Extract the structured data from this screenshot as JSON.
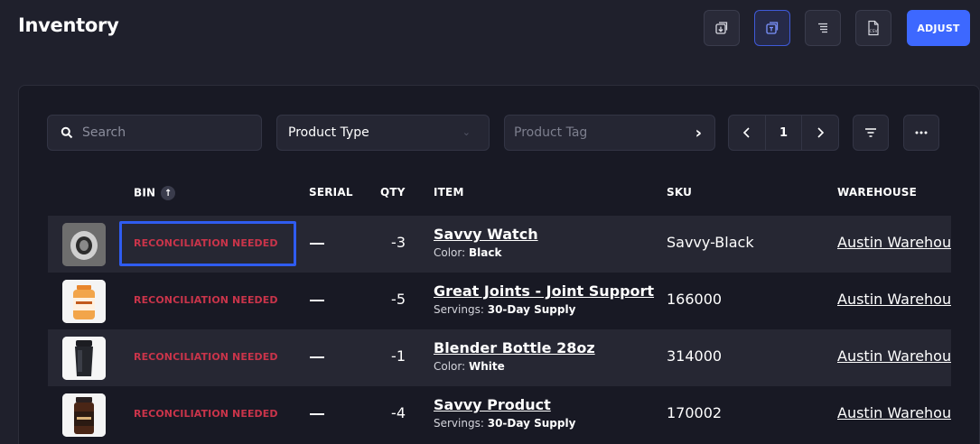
{
  "header": {
    "title": "Inventory",
    "adjust_label": "ADJUST",
    "icons": [
      "import-icon",
      "copy-icon",
      "tree-list-icon",
      "csv-file-icon"
    ]
  },
  "filters": {
    "search_placeholder": "Search",
    "product_type": "Product Type",
    "product_tag_placeholder": "Product Tag",
    "page_number": "1"
  },
  "table": {
    "columns": {
      "bin": "BIN",
      "serial": "SERIAL",
      "qty": "QTY",
      "item": "ITEM",
      "sku": "SKU",
      "warehouse": "WAREHOUSE"
    },
    "rows": [
      {
        "bin": "RECONCILIATION NEEDED",
        "serial": "—",
        "qty": "-3",
        "item_name": "Savvy Watch",
        "attr_label": "Color:",
        "attr_value": "Black",
        "sku": "Savvy-Black",
        "warehouse": "Austin Warehouse"
      },
      {
        "bin": "RECONCILIATION NEEDED",
        "serial": "—",
        "qty": "-5",
        "item_name": "Great Joints - Joint Support",
        "attr_label": "Servings:",
        "attr_value": "30-Day Supply",
        "sku": "166000",
        "warehouse": "Austin Warehouse"
      },
      {
        "bin": "RECONCILIATION NEEDED",
        "serial": "—",
        "qty": "-1",
        "item_name": "Blender Bottle 28oz",
        "attr_label": "Color:",
        "attr_value": "White",
        "sku": "314000",
        "warehouse": "Austin Warehouse"
      },
      {
        "bin": "RECONCILIATION NEEDED",
        "serial": "—",
        "qty": "-4",
        "item_name": "Savvy Product",
        "attr_label": "Servings:",
        "attr_value": "30-Day Supply",
        "sku": "170002",
        "warehouse": "Austin Warehouse"
      }
    ]
  },
  "colors": {
    "accent": "#3d68ff",
    "warning_text": "#c9344a",
    "background": "#1f202c"
  }
}
